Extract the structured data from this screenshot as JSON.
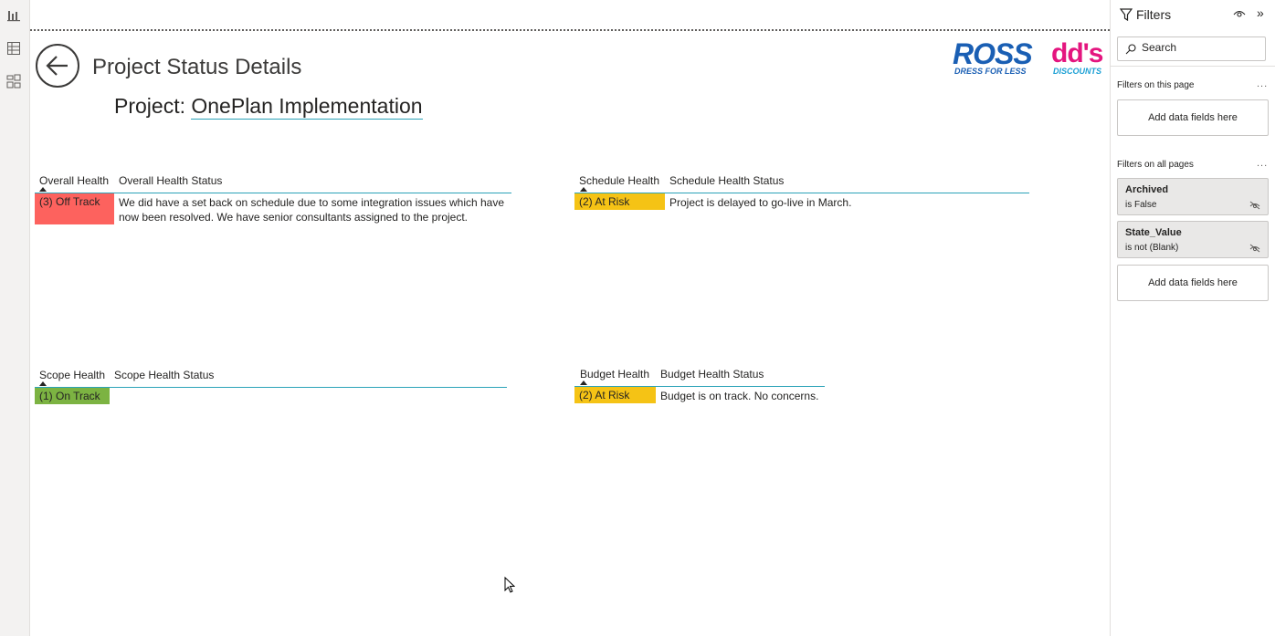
{
  "left_rail": {
    "icons": [
      "report-view-icon",
      "data-view-icon",
      "model-view-icon"
    ]
  },
  "page": {
    "title": "Project Status Details",
    "project_label": "Project:",
    "project_name": "OnePlan Implementation"
  },
  "logo": {
    "ross": "ROSS",
    "ross_tagline": "DRESS FOR LESS",
    "dds": "dd's",
    "dds_tagline": "DISCOUNTS",
    "colors": {
      "ross": "#1a5fb4",
      "dds": "#e4157f",
      "dds_tag": "#1a9fd4"
    }
  },
  "overall": {
    "col1": "Overall Health",
    "col2": "Overall Health Status",
    "value": "(3) Off Track",
    "color": "#fd625e",
    "status": "We did have a set back on schedule due to some integration issues which have now been resolved. We have senior consultants assigned to the project."
  },
  "schedule": {
    "col1": "Schedule Health",
    "col2": "Schedule Health Status",
    "value": "(2) At Risk",
    "color": "#f5c315",
    "status": "Project is delayed to go-live in March."
  },
  "scope": {
    "col1": "Scope Health",
    "col2": "Scope Health Status",
    "value": "(1) On Track",
    "color": "#7cb342",
    "status": ""
  },
  "budget": {
    "col1": "Budget Health",
    "col2": "Budget Health Status",
    "value": "(2) At Risk",
    "color": "#f5c315",
    "status": "Budget is on track. No concerns."
  },
  "filters": {
    "title": "Filters",
    "search_placeholder": "Search",
    "on_this_page": "Filters on this page",
    "on_all_pages": "Filters on all pages",
    "add_fields": "Add data fields here",
    "items": [
      {
        "name": "Archived",
        "condition": "is False"
      },
      {
        "name": "State_Value",
        "condition": "is not (Blank)"
      }
    ],
    "more": "..."
  }
}
